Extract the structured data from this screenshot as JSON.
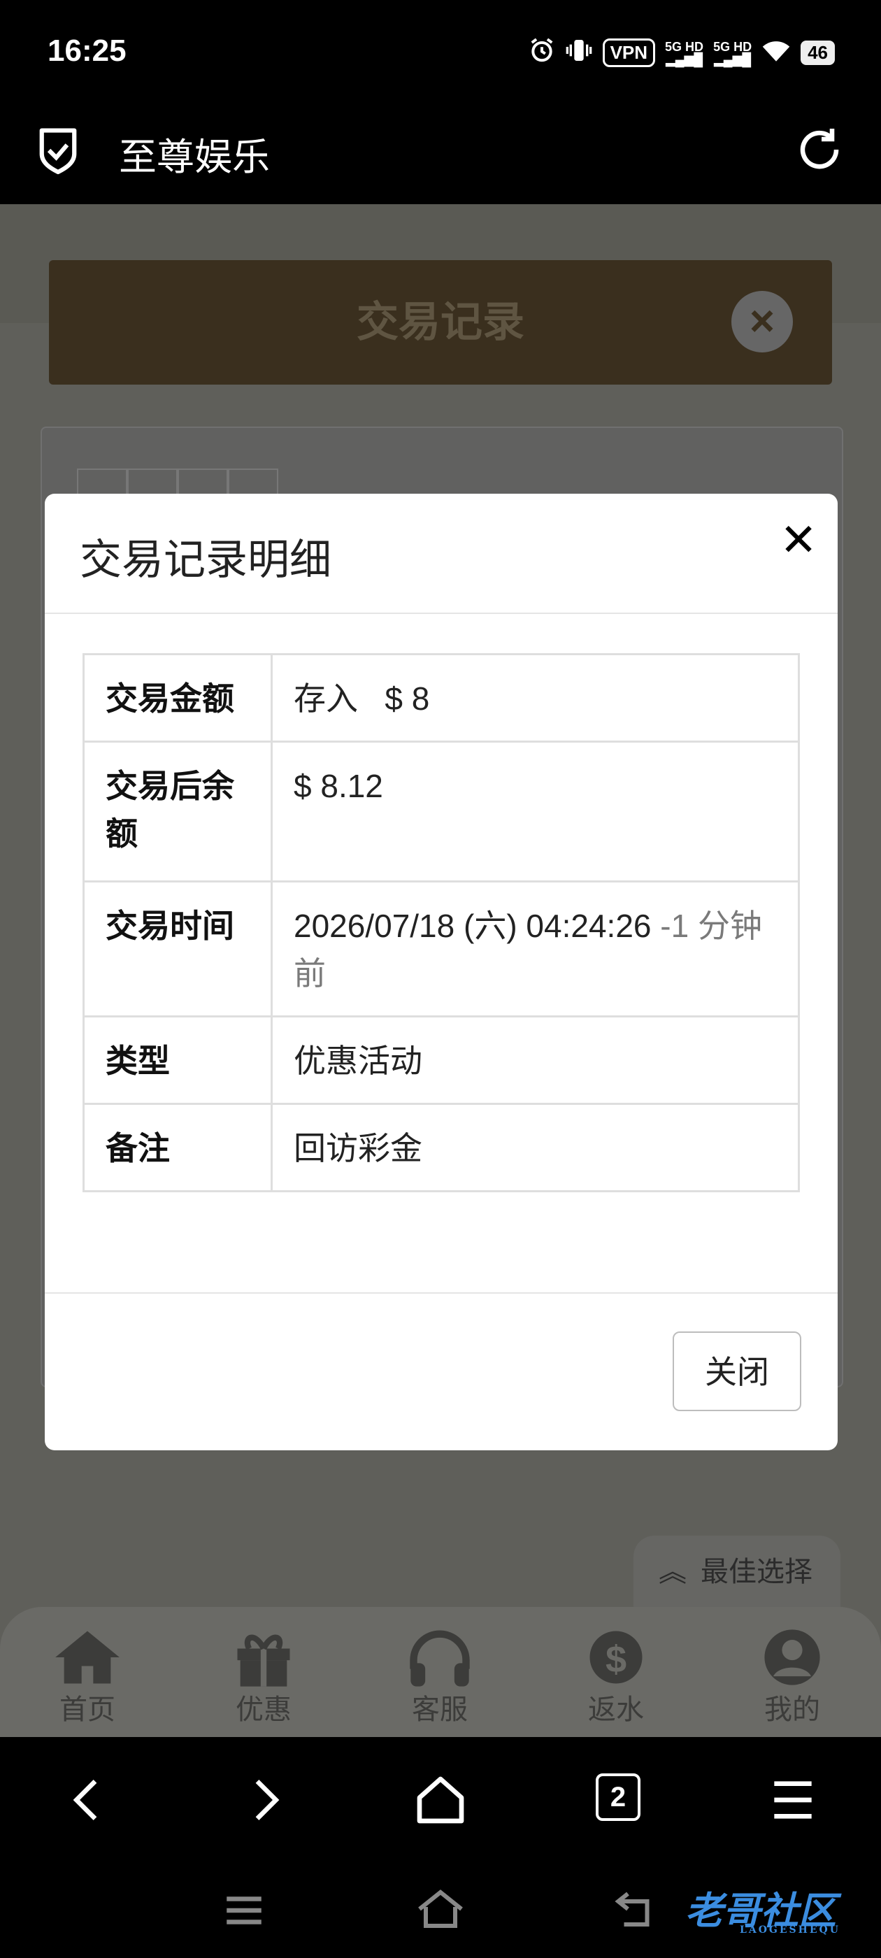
{
  "status_bar": {
    "time": "16:25",
    "vpn": "VPN",
    "signal1": "5G HD",
    "signal2": "5G HD",
    "battery": "46"
  },
  "app_bar": {
    "title": "至尊娱乐"
  },
  "background": {
    "header_title": "交易记录",
    "best_choice": "最佳选择",
    "nav": [
      {
        "label": "首页",
        "icon": "home-icon"
      },
      {
        "label": "优惠",
        "icon": "gift-icon"
      },
      {
        "label": "客服",
        "icon": "headset-icon"
      },
      {
        "label": "返水",
        "icon": "dollar-badge-icon"
      },
      {
        "label": "我的",
        "icon": "user-icon"
      }
    ]
  },
  "modal": {
    "title": "交易记录明细",
    "rows": [
      {
        "key": "交易金额",
        "value_type": "存入",
        "value": "$ 8"
      },
      {
        "key": "交易后余额",
        "value": "$ 8.12"
      },
      {
        "key": "交易时间",
        "value": "2026/07/18 (六) 04:24:26",
        "relative": "-1 分钟前"
      },
      {
        "key": "类型",
        "value": "优惠活动"
      },
      {
        "key": "备注",
        "value": "回访彩金"
      }
    ],
    "close_label": "关闭"
  },
  "browser": {
    "tab_count": "2"
  },
  "watermark": {
    "text": "老哥社区",
    "sub": "LAOGESHEQU"
  },
  "colors": {
    "deposit_green": "#3f7a3f",
    "header_brown": "#3a2f1e"
  }
}
